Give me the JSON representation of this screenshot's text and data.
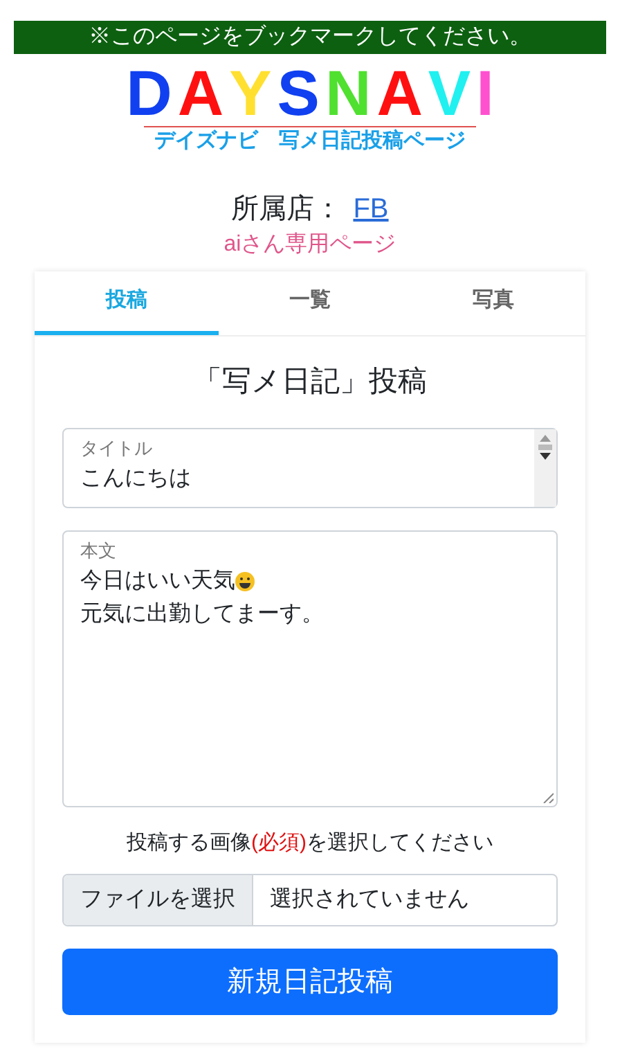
{
  "banner": "※このページをブックマークしてください。",
  "logo": {
    "letters": [
      {
        "char": "D",
        "color": "#1040f0"
      },
      {
        "char": "A",
        "color": "#ff1010"
      },
      {
        "char": "Y",
        "color": "#ffe030"
      },
      {
        "char": "S",
        "color": "#1040f0"
      },
      {
        "char": "N",
        "color": "#50e030"
      },
      {
        "char": "A",
        "color": "#ff1010"
      },
      {
        "char": "V",
        "color": "#20f0f0"
      },
      {
        "char": "I",
        "color": "#ff50d0"
      }
    ],
    "subtitle": "デイズナビ　写メ日記投稿ページ"
  },
  "shop": {
    "label": "所属店：",
    "link": "FB"
  },
  "user_page": "aiさん専用ページ",
  "tabs": [
    {
      "label": "投稿",
      "selected": true
    },
    {
      "label": "一覧",
      "selected": false
    },
    {
      "label": "写真",
      "selected": false
    }
  ],
  "heading": "「写メ日記」投稿",
  "title_field": {
    "label": "タイトル",
    "value": "こんにちは"
  },
  "body_field": {
    "label": "本文",
    "lines": [
      {
        "text": "今日はいい天気",
        "emoji": true
      },
      {
        "text": "元気に出勤してまーす。",
        "emoji": false
      }
    ]
  },
  "image_prompt": "投稿する画像**(必須)**を選択してください",
  "file_input": {
    "button": "ファイルを選択",
    "status": "選択されていません"
  },
  "submit": "新規日記投稿"
}
